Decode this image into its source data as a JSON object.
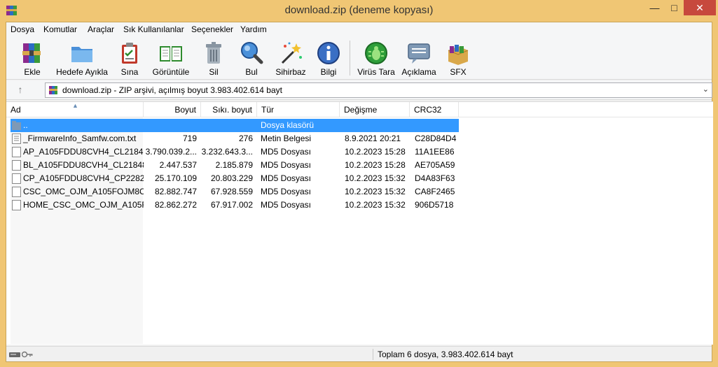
{
  "window": {
    "title": "download.zip (deneme kopyası)"
  },
  "menu": [
    "Dosya",
    "Komutlar",
    "Araçlar",
    "Sık Kullanılanlar",
    "Seçenekler",
    "Yardım"
  ],
  "toolbar": [
    {
      "label": "Ekle",
      "icon": "add-archive-icon"
    },
    {
      "label": "Hedefe Ayıkla",
      "icon": "extract-folder-icon"
    },
    {
      "label": "Sına",
      "icon": "test-clipboard-icon"
    },
    {
      "label": "Görüntüle",
      "icon": "view-book-icon"
    },
    {
      "label": "Sil",
      "icon": "delete-trash-icon"
    },
    {
      "label": "Bul",
      "icon": "find-magnifier-icon"
    },
    {
      "label": "Sihirbaz",
      "icon": "wizard-wand-icon"
    },
    {
      "label": "Bilgi",
      "icon": "info-icon"
    },
    {
      "label": "Virüs Tara",
      "icon": "virus-scan-icon"
    },
    {
      "label": "Açıklama",
      "icon": "comment-icon"
    },
    {
      "label": "SFX",
      "icon": "sfx-box-icon"
    }
  ],
  "address": {
    "text": "download.zip - ZIP arşivi, açılmış boyut 3.983.402.614 bayt"
  },
  "columns": {
    "name": "Ad",
    "size": "Boyut",
    "packed": "Sıkı. boyut",
    "type": "Tür",
    "modified": "Değişme",
    "crc": "CRC32"
  },
  "files": [
    {
      "name": "..",
      "size": "",
      "packed": "",
      "type": "Dosya klasörü",
      "modified": "",
      "crc": "",
      "icon": "folder-icon"
    },
    {
      "name": "_FirmwareInfo_Samfw.com.txt",
      "size": "719",
      "packed": "276",
      "type": "Metin Belgesi",
      "modified": "8.9.2021 20:21",
      "crc": "C28D84D4",
      "icon": "text-file-icon"
    },
    {
      "name": "AP_A105FDDU8CVH4_CL21848...",
      "size": "3.790.039.2...",
      "packed": "3.232.643.3...",
      "type": "MD5 Dosyası",
      "modified": "10.2.2023 15:28",
      "crc": "11A1EE86",
      "icon": "file-icon"
    },
    {
      "name": "BL_A105FDDU8CVH4_CL21848...",
      "size": "2.447.537",
      "packed": "2.185.879",
      "type": "MD5 Dosyası",
      "modified": "10.2.2023 15:28",
      "crc": "AE705A59",
      "icon": "file-icon"
    },
    {
      "name": "CP_A105FDDU8CVH4_CP2282...",
      "size": "25.170.109",
      "packed": "20.803.229",
      "type": "MD5 Dosyası",
      "modified": "10.2.2023 15:32",
      "crc": "D4A83F63",
      "icon": "file-icon"
    },
    {
      "name": "CSC_OMC_OJM_A105FOJM8C...",
      "size": "82.882.747",
      "packed": "67.928.559",
      "type": "MD5 Dosyası",
      "modified": "10.2.2023 15:32",
      "crc": "CA8F2465",
      "icon": "file-icon"
    },
    {
      "name": "HOME_CSC_OMC_OJM_A105F...",
      "size": "82.862.272",
      "packed": "67.917.002",
      "type": "MD5 Dosyası",
      "modified": "10.2.2023 15:32",
      "crc": "906D5718",
      "icon": "file-icon"
    }
  ],
  "status": {
    "text": "Toplam 6 dosya, 3.983.402.614 bayt"
  },
  "colors": {
    "frame": "#f0c674",
    "selection": "#3399ff",
    "close": "#c7493d"
  }
}
